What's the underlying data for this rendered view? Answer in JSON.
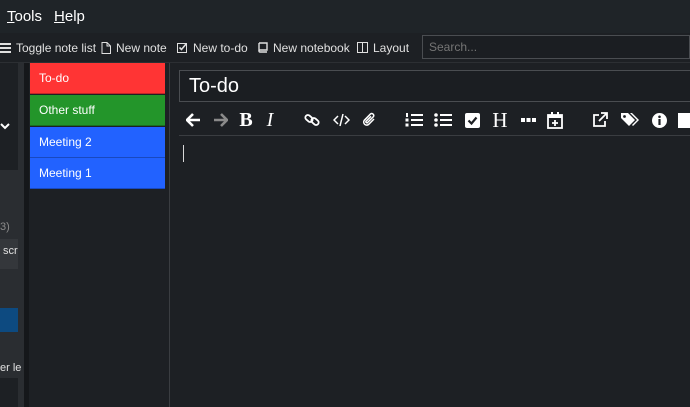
{
  "menu": {
    "tools": "Tools",
    "tools_rest": "ools",
    "help_rest": "elp",
    "help": "Help"
  },
  "toolbar": {
    "toggle_note_list": "Toggle note list",
    "new_note": "New note",
    "new_todo": "New to-do",
    "new_notebook": "New notebook",
    "layout": "Layout"
  },
  "search": {
    "placeholder": "Search..."
  },
  "sidebar": {
    "fragment_count": "3)",
    "fragment_scr": "scr",
    "fragment_ler": "er le"
  },
  "notes": [
    {
      "label": "To-do",
      "color": "#ff3434"
    },
    {
      "label": "Other stuff",
      "color": "#23952a"
    },
    {
      "label": "Meeting 2",
      "color": "#2262ff"
    },
    {
      "label": "Meeting 1",
      "color": "#2262ff"
    }
  ],
  "editor": {
    "title": "To-do",
    "toolbar_icons": [
      "back-icon",
      "forward-icon",
      "bold-icon",
      "italic-icon",
      "link-icon",
      "code-icon",
      "attachment-icon",
      "numbered-list-icon",
      "bulleted-list-icon",
      "checkbox-list-icon",
      "heading-icon",
      "horizontal-rule-icon",
      "insert-date-icon",
      "external-edit-icon",
      "tags-icon",
      "info-icon",
      "toggle-layout-icon"
    ],
    "bold_glyph": "B",
    "italic_glyph": "I",
    "heading_glyph": "H"
  },
  "colors": {
    "background": "#1d2024",
    "sidebar": "#2a2d31",
    "selected": "#0d4a80"
  }
}
